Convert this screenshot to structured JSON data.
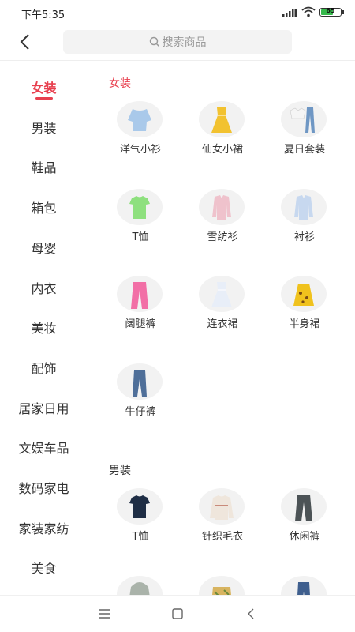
{
  "status": {
    "time": "下午5:35",
    "battery": "65",
    "battery_level": 0.65
  },
  "search": {
    "placeholder": "搜索商品"
  },
  "sidebar": {
    "items": [
      {
        "label": "女装"
      },
      {
        "label": "男装"
      },
      {
        "label": "鞋品"
      },
      {
        "label": "箱包"
      },
      {
        "label": "母婴"
      },
      {
        "label": "内衣"
      },
      {
        "label": "美妆"
      },
      {
        "label": "配饰"
      },
      {
        "label": "居家日用"
      },
      {
        "label": "文娱车品"
      },
      {
        "label": "数码家电"
      },
      {
        "label": "家装家纺"
      },
      {
        "label": "美食"
      }
    ],
    "active": "女装"
  },
  "sections": [
    {
      "title": "女装",
      "title_color": "#e8404f",
      "items": [
        {
          "label": "洋气小衫",
          "icon": "blouse-icon",
          "color": "#a9c9ea"
        },
        {
          "label": "仙女小裙",
          "icon": "dress-icon",
          "color": "#f2c230"
        },
        {
          "label": "夏日套装",
          "icon": "outfit-set-icon",
          "color": "#6f97c4"
        },
        {
          "label": "T恤",
          "icon": "tshirt-icon",
          "color": "#8ee07e"
        },
        {
          "label": "雪纺衫",
          "icon": "shirt-icon",
          "color": "#efc2cc"
        },
        {
          "label": "衬衫",
          "icon": "shirt-icon",
          "color": "#c7d8ef"
        },
        {
          "label": "阔腿裤",
          "icon": "pants-icon",
          "color": "#f26fa6"
        },
        {
          "label": "连衣裙",
          "icon": "dress-icon",
          "color": "#e8eef8"
        },
        {
          "label": "半身裙",
          "icon": "skirt-icon",
          "color": "#f0c21d"
        },
        {
          "label": "牛仔裤",
          "icon": "jeans-icon",
          "color": "#4f6f99"
        }
      ]
    },
    {
      "title": "男装",
      "title_color": "#333333",
      "items": [
        {
          "label": "T恤",
          "icon": "tshirt-icon",
          "color": "#1f2e45"
        },
        {
          "label": "针织毛衣",
          "icon": "sweater-icon",
          "color": "#efe6dc"
        },
        {
          "label": "休闲裤",
          "icon": "pants-icon",
          "color": "#4c5356"
        },
        {
          "label": "",
          "icon": "hoodie-icon",
          "color": "#aab3aa"
        },
        {
          "label": "",
          "icon": "shorts-icon",
          "color": "#d8b460"
        },
        {
          "label": "",
          "icon": "jeans-icon",
          "color": "#3f5f8e"
        }
      ]
    }
  ]
}
